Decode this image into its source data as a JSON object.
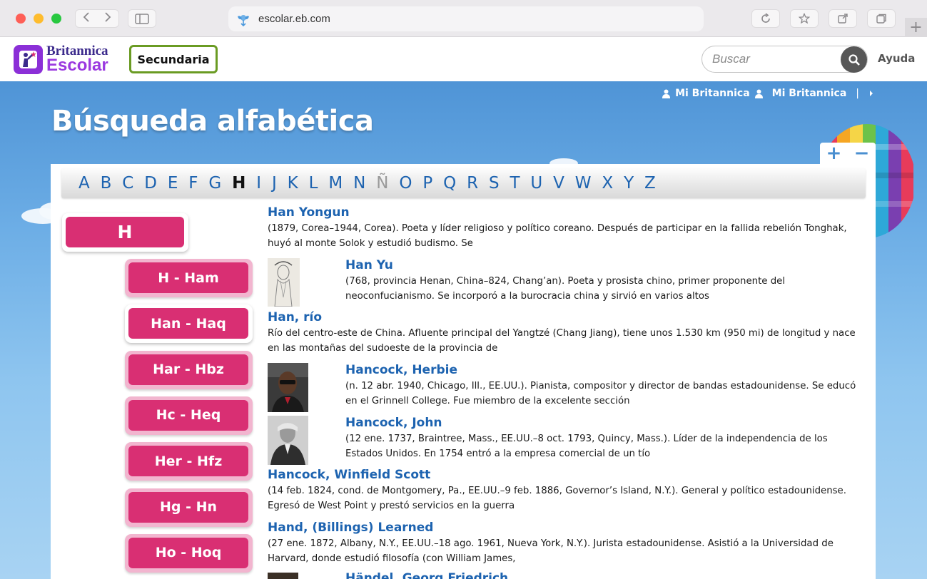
{
  "browser": {
    "url": "escolar.eb.com",
    "new_tab_label": "+"
  },
  "header": {
    "logo_line1": "Britannica",
    "logo_line2": "Escolar",
    "level_button": "Secundaria",
    "search_placeholder": "Buscar",
    "help_link": "Ayuda"
  },
  "user_bar": {
    "link1": "Mi Britannica",
    "link2": "Mi Britannica",
    "separator": "|"
  },
  "page": {
    "title": "Búsqueda alfabética",
    "zoom_in": "+",
    "zoom_out": "−"
  },
  "alphabet": {
    "letters": [
      "A",
      "B",
      "C",
      "D",
      "E",
      "F",
      "G",
      "H",
      "I",
      "J",
      "K",
      "L",
      "M",
      "N",
      "Ñ",
      "O",
      "P",
      "Q",
      "R",
      "S",
      "T",
      "U",
      "V",
      "W",
      "X",
      "Y",
      "Z"
    ],
    "active": "H",
    "disabled": [
      "Ñ"
    ]
  },
  "ranges": {
    "main": "H",
    "items": [
      "H - Ham",
      "Han - Haq",
      "Har - Hbz",
      "Hc - Heq",
      "Her - Hfz",
      "Hg - Hn",
      "Ho - Hoq"
    ],
    "current": "Han - Haq"
  },
  "entries": [
    {
      "title": "Han Yongun",
      "desc": "(1879, Corea–1944, Corea). Poeta y líder religioso y político coreano. Después de participar en la fallida rebelión Tonghak, huyó al monte Solok y estudió budismo. Se",
      "thumb": null
    },
    {
      "title": "Han Yu",
      "desc": "(768, provincia Henan, China–824, Chang’an). Poeta y prosista chino, primer proponente del neoconfucianismo. Se incorporó a la burocracia china y sirvió en varios altos",
      "thumb": "ink-portrait"
    },
    {
      "title": "Han, río",
      "desc": "Río del centro-este de China. Afluente principal del Yangtzé (Chang Jiang), tiene unos 1.530 km (950 mi) de longitud y nace en las montañas del sudoeste de la provincia de",
      "thumb": null
    },
    {
      "title": "Hancock, Herbie",
      "desc": "(n. 12 abr. 1940, Chicago, Ill., EE.UU.). Pianista, compositor y director de bandas estadounidense. Se educó en el Grinnell College. Fue miembro de la excelente sección",
      "thumb": "photo-portrait"
    },
    {
      "title": "Hancock, John",
      "desc": "(12 ene. 1737, Braintree, Mass., EE.UU.–8 oct. 1793, Quincy, Mass.). Líder de la independencia de los Estados Unidos. En 1754 entró a la empresa comercial de un tío",
      "thumb": "engraving-portrait"
    },
    {
      "title": "Hancock, Winfield Scott",
      "desc": "(14 feb. 1824, cond. de Montgomery, Pa., EE.UU.–9 feb. 1886, Governor’s Island, N.Y.). General y político estadounidense. Egresó de West Point y prestó servicios en la guerra",
      "thumb": null
    },
    {
      "title": "Hand, (Billings) Learned",
      "desc": "(27 ene. 1872, Albany, N.Y., EE.UU.–18 ago. 1961, Nueva York, N.Y.). Jurista estadounidense. Asistió a la Universidad de Harvard, donde estudió filosofía (con William James,",
      "thumb": null
    },
    {
      "title": "Händel, Georg Friedrich",
      "desc": "",
      "thumb": "partial-portrait"
    }
  ],
  "colors": {
    "accent_pink": "#d92f73",
    "link_blue": "#1d63b0",
    "level_green": "#6a9b23",
    "logo_purple": "#8b2fd7"
  }
}
